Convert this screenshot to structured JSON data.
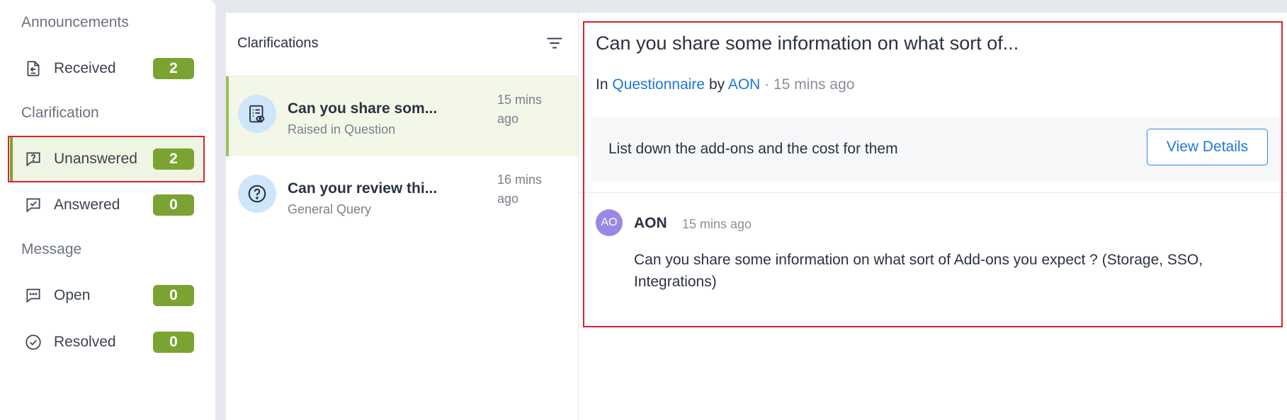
{
  "sidebar": {
    "sections": {
      "announcements": "Announcements",
      "clarification": "Clarification",
      "message": "Message"
    },
    "items": {
      "received": {
        "label": "Received",
        "count": "2",
        "icon": "inbox-in-icon"
      },
      "unanswered": {
        "label": "Unanswered",
        "count": "2",
        "icon": "question-chat-icon"
      },
      "answered": {
        "label": "Answered",
        "count": "0",
        "icon": "check-chat-icon"
      },
      "open": {
        "label": "Open",
        "count": "0",
        "icon": "dots-chat-icon"
      },
      "resolved": {
        "label": "Resolved",
        "count": "0",
        "icon": "check-circle-icon"
      }
    },
    "active_item": "unanswered"
  },
  "list": {
    "title": "Clarifications",
    "items": [
      {
        "title": "Can you share som...",
        "subtitle": "Raised in Question",
        "time": "15 mins ago",
        "icon": "questionnaire-icon"
      },
      {
        "title": "Can your review thi...",
        "subtitle": "General Query",
        "time": "16 mins ago",
        "icon": "question-circle-icon"
      }
    ]
  },
  "detail": {
    "title": "Can you share some information on what sort of...",
    "meta": {
      "in_prefix": "In",
      "category": "Questionnaire",
      "by_prefix": "by",
      "author": "AON",
      "separator": "·",
      "time": "15 mins ago"
    },
    "question": "List down the add-ons and the cost for them",
    "view_details_label": "View Details",
    "comment": {
      "initials": "AO",
      "author": "AON",
      "time": "15 mins ago",
      "body": "Can you share some information on what sort of Add-ons you expect ? (Storage, SSO, Integrations)"
    }
  },
  "colors": {
    "accent_green": "#7aa332",
    "link_blue": "#1e78d7",
    "highlight_red": "#d8232a",
    "avatar_purple": "#9b87e8"
  }
}
